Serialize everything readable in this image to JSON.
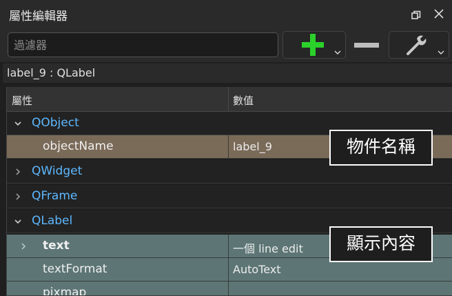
{
  "panel": {
    "title": "屬性編輯器"
  },
  "toolbar": {
    "filter_placeholder": "過濾器",
    "add_icon": "plus-icon",
    "remove_icon": "minus-icon",
    "config_icon": "wrench-icon"
  },
  "object_label": "label_9 : QLabel",
  "table": {
    "col_property": "屬性",
    "col_value": "數值",
    "rows": [
      {
        "kind": "group",
        "label": "QObject",
        "expanded": true
      },
      {
        "kind": "property",
        "label": "objectName",
        "value": "label_9"
      },
      {
        "kind": "group",
        "label": "QWidget",
        "expanded": false
      },
      {
        "kind": "group",
        "label": "QFrame",
        "expanded": false
      },
      {
        "kind": "group",
        "label": "QLabel",
        "expanded": true
      },
      {
        "kind": "property",
        "label": "text",
        "value": "一個 line edit",
        "bold": true
      },
      {
        "kind": "property",
        "label": "textFormat",
        "value": "AutoText"
      },
      {
        "kind": "property",
        "label": "pixmap",
        "value": ""
      }
    ]
  },
  "annotations": {
    "object_name_note": "物件名稱",
    "text_note": "顯示內容"
  },
  "colors": {
    "group_label": "#5db8ff",
    "selected_row": "#7a6a58",
    "qlabel_rows": "#5d7575",
    "add_icon": "#2bd02b"
  }
}
